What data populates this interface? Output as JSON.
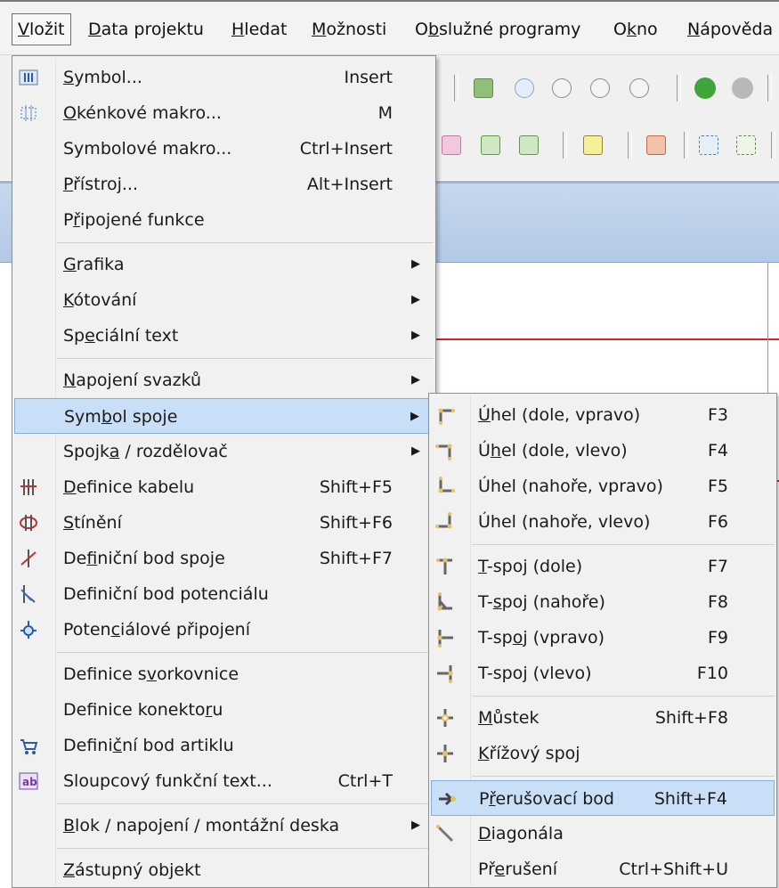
{
  "menubar": {
    "items": [
      {
        "text": "Vložit",
        "u": "V",
        "rest": "ložit"
      },
      {
        "text": "Data projektu",
        "u": "D",
        "rest": "ata projektu"
      },
      {
        "text": "Hledat",
        "u": "H",
        "rest": "ledat"
      },
      {
        "text": "Možnosti",
        "u": "M",
        "rest": "ožnosti"
      },
      {
        "pre": "O",
        "u": "b",
        "rest": "služné programy"
      },
      {
        "pre": "O",
        "u": "k",
        "rest": "no"
      },
      {
        "text": "Nápověda",
        "u": "N",
        "rest": "ápověda"
      }
    ]
  },
  "main_menu": {
    "items": [
      {
        "pre": "",
        "u": "S",
        "post": "ymbol...",
        "shortcut": "Insert",
        "icon": "symbol-icon"
      },
      {
        "pre": "",
        "u": "O",
        "post": "kénkové makro...",
        "shortcut": "M",
        "icon": "window-macro-icon"
      },
      {
        "pre": "Symbolové makro...",
        "u": "",
        "post": "",
        "shortcut": "Ctrl+Insert"
      },
      {
        "pre": "",
        "u": "P",
        "post": "řístroj...",
        "shortcut": "Alt+Insert"
      },
      {
        "pre": "P",
        "u": "ř",
        "post": "ipojené funkce",
        "shortcut": ""
      },
      {
        "pre": "",
        "u": "G",
        "post": "rafika",
        "shortcut": "",
        "submenu": true
      },
      {
        "pre": "",
        "u": "K",
        "post": "ótování",
        "shortcut": "",
        "submenu": true
      },
      {
        "pre": "Sp",
        "u": "e",
        "post": "ciální text",
        "shortcut": "",
        "submenu": true
      },
      {
        "pre": "",
        "u": "N",
        "post": "apojení svazků",
        "shortcut": "",
        "submenu": true
      },
      {
        "pre": "Sym",
        "u": "b",
        "post": "ol spoje",
        "shortcut": "",
        "submenu": true
      },
      {
        "pre": "Spojk",
        "u": "a",
        "post": " / rozdělovač",
        "shortcut": "",
        "submenu": true
      },
      {
        "pre": "",
        "u": "D",
        "post": "efinice kabelu",
        "shortcut": "Shift+F5",
        "icon": "cable-definition-icon"
      },
      {
        "pre": "",
        "u": "S",
        "post": "tínění",
        "shortcut": "Shift+F6",
        "icon": "shielding-icon"
      },
      {
        "pre": "De",
        "u": "f",
        "post": "iniční bod spoje",
        "shortcut": "Shift+F7",
        "icon": "connection-point-icon"
      },
      {
        "pre": "Def",
        "u": "i",
        "post": "niční bod potenciálu",
        "shortcut": "",
        "icon": "potential-point-icon"
      },
      {
        "pre": "Poten",
        "u": "c",
        "post": "iálové připojení",
        "shortcut": "",
        "icon": "potential-connection-icon"
      },
      {
        "pre": "Definice s",
        "u": "v",
        "post": "orkovnice",
        "shortcut": ""
      },
      {
        "pre": "Definice konekto",
        "u": "r",
        "post": "u",
        "shortcut": ""
      },
      {
        "pre": "Defini",
        "u": "č",
        "post": "ní bod artiklu",
        "shortcut": "",
        "icon": "article-point-icon"
      },
      {
        "pre": "Sloupcový funkční text...",
        "u": "",
        "post": "",
        "shortcut": "Ctrl+T",
        "icon": "column-text-icon"
      },
      {
        "pre": "",
        "u": "B",
        "post": "lok / napojení / montážní deska",
        "shortcut": "",
        "submenu": true
      },
      {
        "pre": "",
        "u": "Z",
        "post": "ástupný objekt",
        "shortcut": ""
      }
    ]
  },
  "sub_menu": {
    "items": [
      {
        "pre": "",
        "u": "Ú",
        "post": "hel (dole, vpravo)",
        "shortcut": "F3"
      },
      {
        "pre": "Ú",
        "u": "h",
        "post": "el (dole, vlevo)",
        "shortcut": "F4"
      },
      {
        "pre": "Úhel (nahoře, vpravo)",
        "u": "",
        "post": "",
        "shortcut": "F5"
      },
      {
        "pre": "Úhel (nahoře, vlevo)",
        "u": "",
        "post": "",
        "shortcut": "F6"
      },
      {
        "pre": "",
        "u": "T",
        "post": "-spoj (dole)",
        "shortcut": "F7"
      },
      {
        "pre": "T-",
        "u": "s",
        "post": "poj (nahoře)",
        "shortcut": "F8"
      },
      {
        "pre": "T-sp",
        "u": "o",
        "post": "j (vpravo)",
        "shortcut": "F9"
      },
      {
        "pre": "T-spo",
        "u": "j",
        "post": " (vlevo)",
        "shortcut": "F10"
      },
      {
        "pre": "",
        "u": "M",
        "post": "ůstek",
        "shortcut": "Shift+F8"
      },
      {
        "pre": "",
        "u": "K",
        "post": "řížový spoj",
        "shortcut": ""
      },
      {
        "pre": "P",
        "u": "ř",
        "post": "erušovací bod",
        "shortcut": "Shift+F4"
      },
      {
        "pre": "",
        "u": "D",
        "post": "iagonála",
        "shortcut": ""
      },
      {
        "pre": "Př",
        "u": "e",
        "post": "rušení",
        "shortcut": "Ctrl+Shift+U"
      }
    ]
  },
  "colors": {
    "highlight": "#c9dff7",
    "highlight_border": "#84acdd",
    "menu_bg": "#f1f1f1",
    "corner_icon_fill": "#e8d7a0",
    "red_line": "#dd2020"
  }
}
